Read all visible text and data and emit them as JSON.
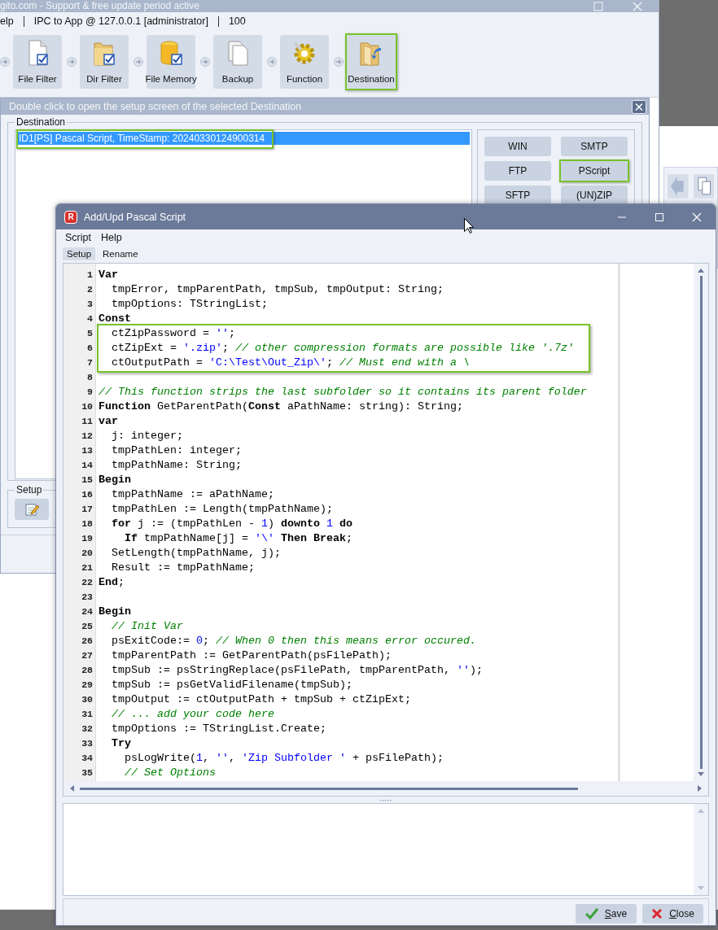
{
  "main_window": {
    "title": "gito.com - Support & free update period active",
    "menu": [
      "elp",
      "IPC to App @ 127.0.0.1 [administrator]",
      "100"
    ],
    "toolbar": [
      {
        "label": "File Filter",
        "highlighted": false
      },
      {
        "label": "Dir Filter",
        "highlighted": false
      },
      {
        "label": "File Memory",
        "highlighted": false
      },
      {
        "label": "Backup",
        "highlighted": false
      },
      {
        "label": "Function",
        "highlighted": false
      },
      {
        "label": "Destination",
        "highlighted": true
      }
    ]
  },
  "destination_dialog": {
    "title": "Double click to open the setup screen of the selected Destination",
    "group_label": "Destination",
    "items": [
      {
        "label": "ID1[PS] Pascal Script, TimeStamp: 20240330124900314",
        "selected": true,
        "highlighted": true
      }
    ],
    "buttons": [
      {
        "label": "WIN",
        "highlighted": false
      },
      {
        "label": "SMTP",
        "highlighted": false
      },
      {
        "label": "FTP",
        "highlighted": false
      },
      {
        "label": "PScript",
        "highlighted": true
      },
      {
        "label": "SFTP",
        "highlighted": false
      },
      {
        "label": "(UN)ZIP",
        "highlighted": false
      }
    ],
    "setup_label": "Setup"
  },
  "script_window": {
    "logo_letter": "R",
    "title": "Add/Upd Pascal Script",
    "menu": [
      "Script",
      "Help"
    ],
    "tabs": [
      {
        "label": "Setup",
        "selected": true
      },
      {
        "label": "Rename",
        "selected": false
      }
    ],
    "code_lines": [
      {
        "number": "1",
        "highlighted": false,
        "tokens": [
          {
            "kind": "keyword",
            "text": "Var"
          }
        ]
      },
      {
        "number": "2",
        "highlighted": false,
        "tokens": [
          {
            "kind": "plain",
            "text": "  tmpError, tmpParentPath, tmpSub, tmpOutput: String;"
          }
        ]
      },
      {
        "number": "3",
        "highlighted": false,
        "tokens": [
          {
            "kind": "plain",
            "text": "  tmpOptions: TStringList;"
          }
        ]
      },
      {
        "number": "4",
        "highlighted": false,
        "tokens": [
          {
            "kind": "keyword",
            "text": "Const"
          }
        ]
      },
      {
        "number": "5",
        "highlighted": true,
        "tokens": [
          {
            "kind": "plain",
            "text": "  ctZipPassword = "
          },
          {
            "kind": "string",
            "text": "''"
          },
          {
            "kind": "plain",
            "text": ";"
          }
        ]
      },
      {
        "number": "6",
        "highlighted": true,
        "tokens": [
          {
            "kind": "plain",
            "text": "  ctZipExt = "
          },
          {
            "kind": "string",
            "text": "'.zip'"
          },
          {
            "kind": "plain",
            "text": "; "
          },
          {
            "kind": "comment",
            "text": "// other compression formats are possible like '.7z'"
          }
        ]
      },
      {
        "number": "7",
        "highlighted": true,
        "tokens": [
          {
            "kind": "plain",
            "text": "  ctOutputPath = "
          },
          {
            "kind": "string",
            "text": "'C:\\Test\\Out_Zip\\'"
          },
          {
            "kind": "plain",
            "text": "; "
          },
          {
            "kind": "comment",
            "text": "// Must end with a \\"
          }
        ]
      },
      {
        "number": "8",
        "highlighted": false
      },
      {
        "number": "9",
        "highlighted": false,
        "tokens": [
          {
            "kind": "comment",
            "text": "// This function strips the last subfolder so it contains its parent folder"
          }
        ]
      },
      {
        "number": "10",
        "highlighted": false,
        "tokens": [
          {
            "kind": "keyword",
            "text": "Function"
          },
          {
            "kind": "plain",
            "text": " GetParentPath("
          },
          {
            "kind": "keyword",
            "text": "Const"
          },
          {
            "kind": "plain",
            "text": " aPathName: string): String;"
          }
        ]
      },
      {
        "number": "11",
        "highlighted": false,
        "tokens": [
          {
            "kind": "keyword",
            "text": "var"
          }
        ]
      },
      {
        "number": "12",
        "highlighted": false,
        "tokens": [
          {
            "kind": "plain",
            "text": "  j: integer;"
          }
        ]
      },
      {
        "number": "13",
        "highlighted": false,
        "tokens": [
          {
            "kind": "plain",
            "text": "  tmpPathLen: integer;"
          }
        ]
      },
      {
        "number": "14",
        "highlighted": false,
        "tokens": [
          {
            "kind": "plain",
            "text": "  tmpPathName: String;"
          }
        ]
      },
      {
        "number": "15",
        "highlighted": false,
        "tokens": [
          {
            "kind": "keyword",
            "text": "Begin"
          }
        ]
      },
      {
        "number": "16",
        "highlighted": false,
        "tokens": [
          {
            "kind": "plain",
            "text": "  tmpPathName := aPathName;"
          }
        ]
      },
      {
        "number": "17",
        "highlighted": false,
        "tokens": [
          {
            "kind": "plain",
            "text": "  tmpPathLen := Length(tmpPathName);"
          }
        ]
      },
      {
        "number": "18",
        "highlighted": false,
        "tokens": [
          {
            "kind": "keyword",
            "text": "  for"
          },
          {
            "kind": "plain",
            "text": " j := (tmpPathLen - "
          },
          {
            "kind": "number",
            "text": "1"
          },
          {
            "kind": "plain",
            "text": ") "
          },
          {
            "kind": "keyword",
            "text": "downto"
          },
          {
            "kind": "number",
            "text": " 1"
          },
          {
            "kind": "keyword",
            "text": " do"
          }
        ]
      },
      {
        "number": "19",
        "highlighted": false,
        "tokens": [
          {
            "kind": "keyword",
            "text": "    If"
          },
          {
            "kind": "plain",
            "text": " tmpPathName[j] = "
          },
          {
            "kind": "string",
            "text": "'\\'"
          },
          {
            "kind": "keyword",
            "text": " Then"
          },
          {
            "kind": "keyword",
            "text": " Break"
          },
          {
            "kind": "plain",
            "text": ";"
          }
        ]
      },
      {
        "number": "20",
        "highlighted": false,
        "tokens": [
          {
            "kind": "plain",
            "text": "  SetLength(tmpPathName, j);"
          }
        ]
      },
      {
        "number": "21",
        "highlighted": false,
        "tokens": [
          {
            "kind": "plain",
            "text": "  Result := tmpPathName;"
          }
        ]
      },
      {
        "number": "22",
        "highlighted": false,
        "tokens": [
          {
            "kind": "keyword",
            "text": "End"
          },
          {
            "kind": "plain",
            "text": ";"
          }
        ]
      },
      {
        "number": "23",
        "highlighted": false
      },
      {
        "number": "24",
        "highlighted": false,
        "tokens": [
          {
            "kind": "keyword",
            "text": "Begin"
          }
        ]
      },
      {
        "number": "25",
        "highlighted": false,
        "tokens": [
          {
            "kind": "comment",
            "text": "  // Init Var"
          }
        ]
      },
      {
        "number": "26",
        "highlighted": false,
        "tokens": [
          {
            "kind": "plain",
            "text": "  psExitCode:= "
          },
          {
            "kind": "number",
            "text": "0"
          },
          {
            "kind": "plain",
            "text": "; "
          },
          {
            "kind": "comment",
            "text": "// When 0 then this means error occured."
          }
        ]
      },
      {
        "number": "27",
        "highlighted": false,
        "tokens": [
          {
            "kind": "plain",
            "text": "  tmpParentPath := GetParentPath(psFilePath);"
          }
        ]
      },
      {
        "number": "28",
        "highlighted": false,
        "tokens": [
          {
            "kind": "plain",
            "text": "  tmpSub := psStringReplace(psFilePath, tmpParentPath, "
          },
          {
            "kind": "string",
            "text": "''"
          },
          {
            "kind": "plain",
            "text": ");"
          }
        ]
      },
      {
        "number": "29",
        "highlighted": false,
        "tokens": [
          {
            "kind": "plain",
            "text": "  tmpSub := psGetValidFilename(tmpSub);"
          }
        ]
      },
      {
        "number": "30",
        "highlighted": false,
        "tokens": [
          {
            "kind": "plain",
            "text": "  tmpOutput := ctOutputPath + tmpSub + ctZipExt;"
          }
        ]
      },
      {
        "number": "31",
        "highlighted": false,
        "tokens": [
          {
            "kind": "comment",
            "text": "  // ... add your code here"
          }
        ]
      },
      {
        "number": "32",
        "highlighted": false,
        "tokens": [
          {
            "kind": "plain",
            "text": "  tmpOptions := TStringList.Create;"
          }
        ]
      },
      {
        "number": "33",
        "highlighted": false,
        "tokens": [
          {
            "kind": "keyword",
            "text": "  Try"
          }
        ]
      },
      {
        "number": "34",
        "highlighted": false,
        "tokens": [
          {
            "kind": "plain",
            "text": "    psLogWrite("
          },
          {
            "kind": "number",
            "text": "1"
          },
          {
            "kind": "plain",
            "text": ", "
          },
          {
            "kind": "string",
            "text": "''"
          },
          {
            "kind": "plain",
            "text": ", "
          },
          {
            "kind": "string",
            "text": "'Zip Subfolder '"
          },
          {
            "kind": "plain",
            "text": " + psFilePath);"
          }
        ]
      },
      {
        "number": "35",
        "highlighted": false,
        "tokens": [
          {
            "kind": "comment",
            "text": "    // Set Options"
          }
        ]
      }
    ],
    "buttons": [
      {
        "kind": "save",
        "label": "Save"
      },
      {
        "kind": "close",
        "label": "Close"
      }
    ]
  }
}
